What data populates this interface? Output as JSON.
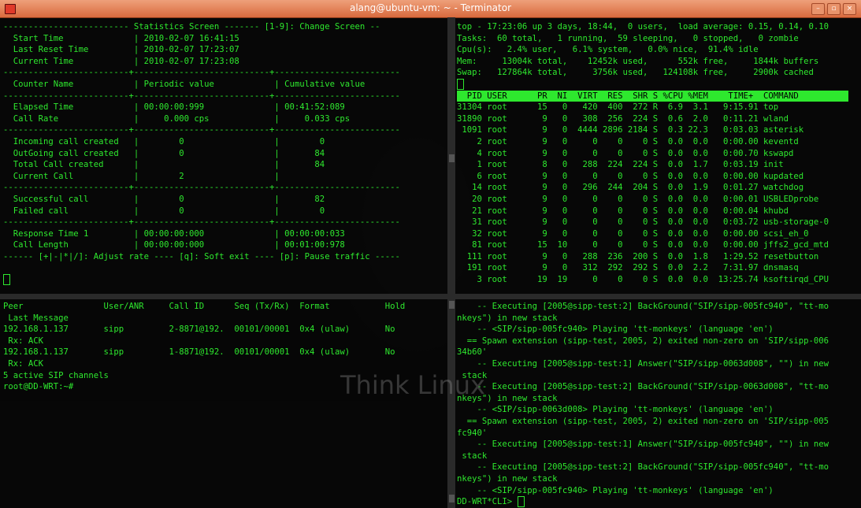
{
  "window": {
    "title": "alang@ubuntu-vm: ~ - Terminator",
    "buttons": [
      "–",
      "▫",
      "×"
    ]
  },
  "watermark": "Think Linux",
  "stats": {
    "lines": [
      "------------------------- Statistics Screen ------- [1-9]: Change Screen --",
      "  Start Time              | 2010-02-07 16:41:15",
      "  Last Reset Time         | 2010-02-07 17:23:07",
      "  Current Time            | 2010-02-07 17:23:08",
      "-------------------------+---------------------------+-------------------------",
      "  Counter Name            | Periodic value            | Cumulative value",
      "-------------------------+---------------------------+-------------------------",
      "  Elapsed Time            | 00:00:00:999              | 00:41:52:089",
      "  Call Rate               |     0.000 cps             |     0.033 cps",
      "-------------------------+---------------------------+-------------------------",
      "  Incoming call created   |        0                  |        0",
      "  OutGoing call created   |        0                  |       84",
      "  Total Call created      |                           |       84",
      "  Current Call            |        2                  |",
      "-------------------------+---------------------------+-------------------------",
      "  Successful call         |        0                  |       82",
      "  Failed call             |        0                  |        0",
      "-------------------------+---------------------------+-------------------------",
      "  Response Time 1         | 00:00:00:000              | 00:00:00:033",
      "  Call Length             | 00:00:00:000              | 00:01:00:978",
      "------ [+|-|*|/]: Adjust rate ---- [q]: Soft exit ---- [p]: Pause traffic -----"
    ]
  },
  "top": {
    "header": [
      "top - 17:23:06 up 3 days, 18:44,  0 users,  load average: 0.15, 0.14, 0.10",
      "Tasks:  60 total,   1 running,  59 sleeping,   0 stopped,   0 zombie",
      "Cpu(s):   2.4% user,   6.1% system,   0.0% nice,  91.4% idle",
      "Mem:     13004k total,    12452k used,      552k free,     1844k buffers",
      "Swap:   127864k total,     3756k used,   124108k free,     2900k cached"
    ],
    "columns": "  PID USER      PR  NI  VIRT  RES  SHR S %CPU %MEM    TIME+  COMMAND          ",
    "rows": [
      "31304 root      15   0   420  400  272 R  6.9  3.1   9:15.91 top",
      "31890 root       9   0   308  256  224 S  0.6  2.0   0:11.21 wland",
      " 1091 root       9   0  4444 2896 2184 S  0.3 22.3   0:03.03 asterisk",
      "    2 root       9   0     0    0    0 S  0.0  0.0   0:00.00 keventd",
      "    4 root       9   0     0    0    0 S  0.0  0.0   0:00.70 kswapd",
      "    1 root       8   0   288  224  224 S  0.0  1.7   0:03.19 init",
      "    6 root       9   0     0    0    0 S  0.0  0.0   0:00.00 kupdated",
      "   14 root       9   0   296  244  204 S  0.0  1.9   0:01.27 watchdog",
      "   20 root       9   0     0    0    0 S  0.0  0.0   0:00.01 USBLEDprobe",
      "   21 root       9   0     0    0    0 S  0.0  0.0   0:00.04 khubd",
      "   31 root       9   0     0    0    0 S  0.0  0.0   0:03.72 usb-storage-0",
      "   32 root       9   0     0    0    0 S  0.0  0.0   0:00.00 scsi_eh_0",
      "   81 root      15  10     0    0    0 S  0.0  0.0   0:00.00 jffs2_gcd_mtd",
      "  111 root       9   0   288  236  200 S  0.0  1.8   1:29.52 resetbutton",
      "  191 root       9   0   312  292  292 S  0.0  2.2   7:31.97 dnsmasq",
      "    3 root      19  19     0    0    0 S  0.0  0.0  13:25.74 ksoftirqd_CPU"
    ]
  },
  "sip": {
    "lines": [
      "Peer                User/ANR     Call ID      Seq (Tx/Rx)  Format           Hold",
      " Last Message",
      "192.168.1.137       sipp         2-8871@192.  00101/00001  0x4 (ulaw)       No",
      " Rx: ACK",
      "192.168.1.137       sipp         1-8871@192.  00101/00001  0x4 (ulaw)       No",
      " Rx: ACK",
      "5 active SIP channels",
      "root@DD-WRT:~#"
    ]
  },
  "asterisk": {
    "lines": [
      "    -- Executing [2005@sipp-test:2] BackGround(\"SIP/sipp-005fc940\", \"tt-mo",
      "nkeys\") in new stack",
      "    -- <SIP/sipp-005fc940> Playing 'tt-monkeys' (language 'en')",
      "  == Spawn extension (sipp-test, 2005, 2) exited non-zero on 'SIP/sipp-006",
      "34b60'",
      "    -- Executing [2005@sipp-test:1] Answer(\"SIP/sipp-0063d008\", \"\") in new",
      " stack",
      "    -- Executing [2005@sipp-test:2] BackGround(\"SIP/sipp-0063d008\", \"tt-mo",
      "nkeys\") in new stack",
      "    -- <SIP/sipp-0063d008> Playing 'tt-monkeys' (language 'en')",
      "  == Spawn extension (sipp-test, 2005, 2) exited non-zero on 'SIP/sipp-005",
      "fc940'",
      "    -- Executing [2005@sipp-test:1] Answer(\"SIP/sipp-005fc940\", \"\") in new",
      " stack",
      "    -- Executing [2005@sipp-test:2] BackGround(\"SIP/sipp-005fc940\", \"tt-mo",
      "nkeys\") in new stack",
      "    -- <SIP/sipp-005fc940> Playing 'tt-monkeys' (language 'en')"
    ],
    "prompt": "DD-WRT*CLI> "
  }
}
